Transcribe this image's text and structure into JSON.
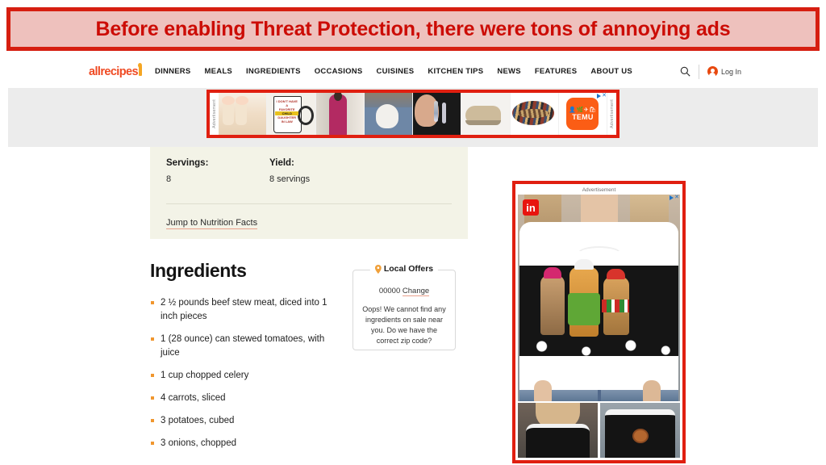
{
  "annotation": {
    "banner_text": "Before enabling Threat Protection, there were tons of annoying ads",
    "border_color": "#d61e10",
    "fill_color": "#eec1bd",
    "text_color": "#cc0c05"
  },
  "nav": {
    "brand": "allrecipes",
    "links": [
      "DINNERS",
      "MEALS",
      "INGREDIENTS",
      "OCCASIONS",
      "CUISINES",
      "KITCHEN TIPS",
      "NEWS",
      "FEATURES",
      "ABOUT US"
    ],
    "search_icon": "search-icon",
    "account_icon": "account-avatar-icon",
    "login_label": "Log In",
    "accent_color": "#ef4a23"
  },
  "top_ad": {
    "label_left": "Advertisement",
    "label_right": "Advertisement",
    "brand": "TEMU",
    "adchoices_icon": "adchoices-icon",
    "close_icon": "close-icon",
    "highlight_color": "#e01f10",
    "products": [
      "toe-separator-socks",
      "favorite-child-mug",
      "pink-jumpsuit",
      "dog-in-jeans",
      "moonstone-earrings",
      "tan-sneaker",
      "patterned-headband",
      "temu-logo"
    ]
  },
  "recipe": {
    "servings_label": "Servings:",
    "servings_value": "8",
    "yield_label": "Yield:",
    "yield_value": "8 servings",
    "nutrition_link": "Jump to Nutrition Facts",
    "card_color": "#f3f3e7"
  },
  "ingredients": {
    "title": "Ingredients",
    "bullet_color": "#f0962e",
    "items": [
      "2 ½ pounds beef stew meat, diced into 1 inch pieces",
      "1 (28 ounce) can stewed tomatoes, with juice",
      "1 cup chopped celery",
      "4 carrots, sliced",
      "3 potatoes, cubed",
      "3 onions, chopped"
    ]
  },
  "local_offers": {
    "pin_icon": "map-pin-icon",
    "title": "Local Offers",
    "zip": "00000",
    "change_label": "Change",
    "message": "Oops! We cannot find any ingredients on sale near you. Do we have the correct zip code?"
  },
  "sidebar_ad": {
    "label": "Advertisement",
    "badge": "in",
    "badge_icon": "linkedin-badge-icon",
    "adchoices_icon": "adchoices-icon",
    "close_icon": "close-icon",
    "highlight_color": "#e01f10",
    "creative": "christmas-cat-sweater",
    "thumbnails": [
      "black-fur-trim-vneck-sweater",
      "reindeer-lights-sweater"
    ]
  }
}
